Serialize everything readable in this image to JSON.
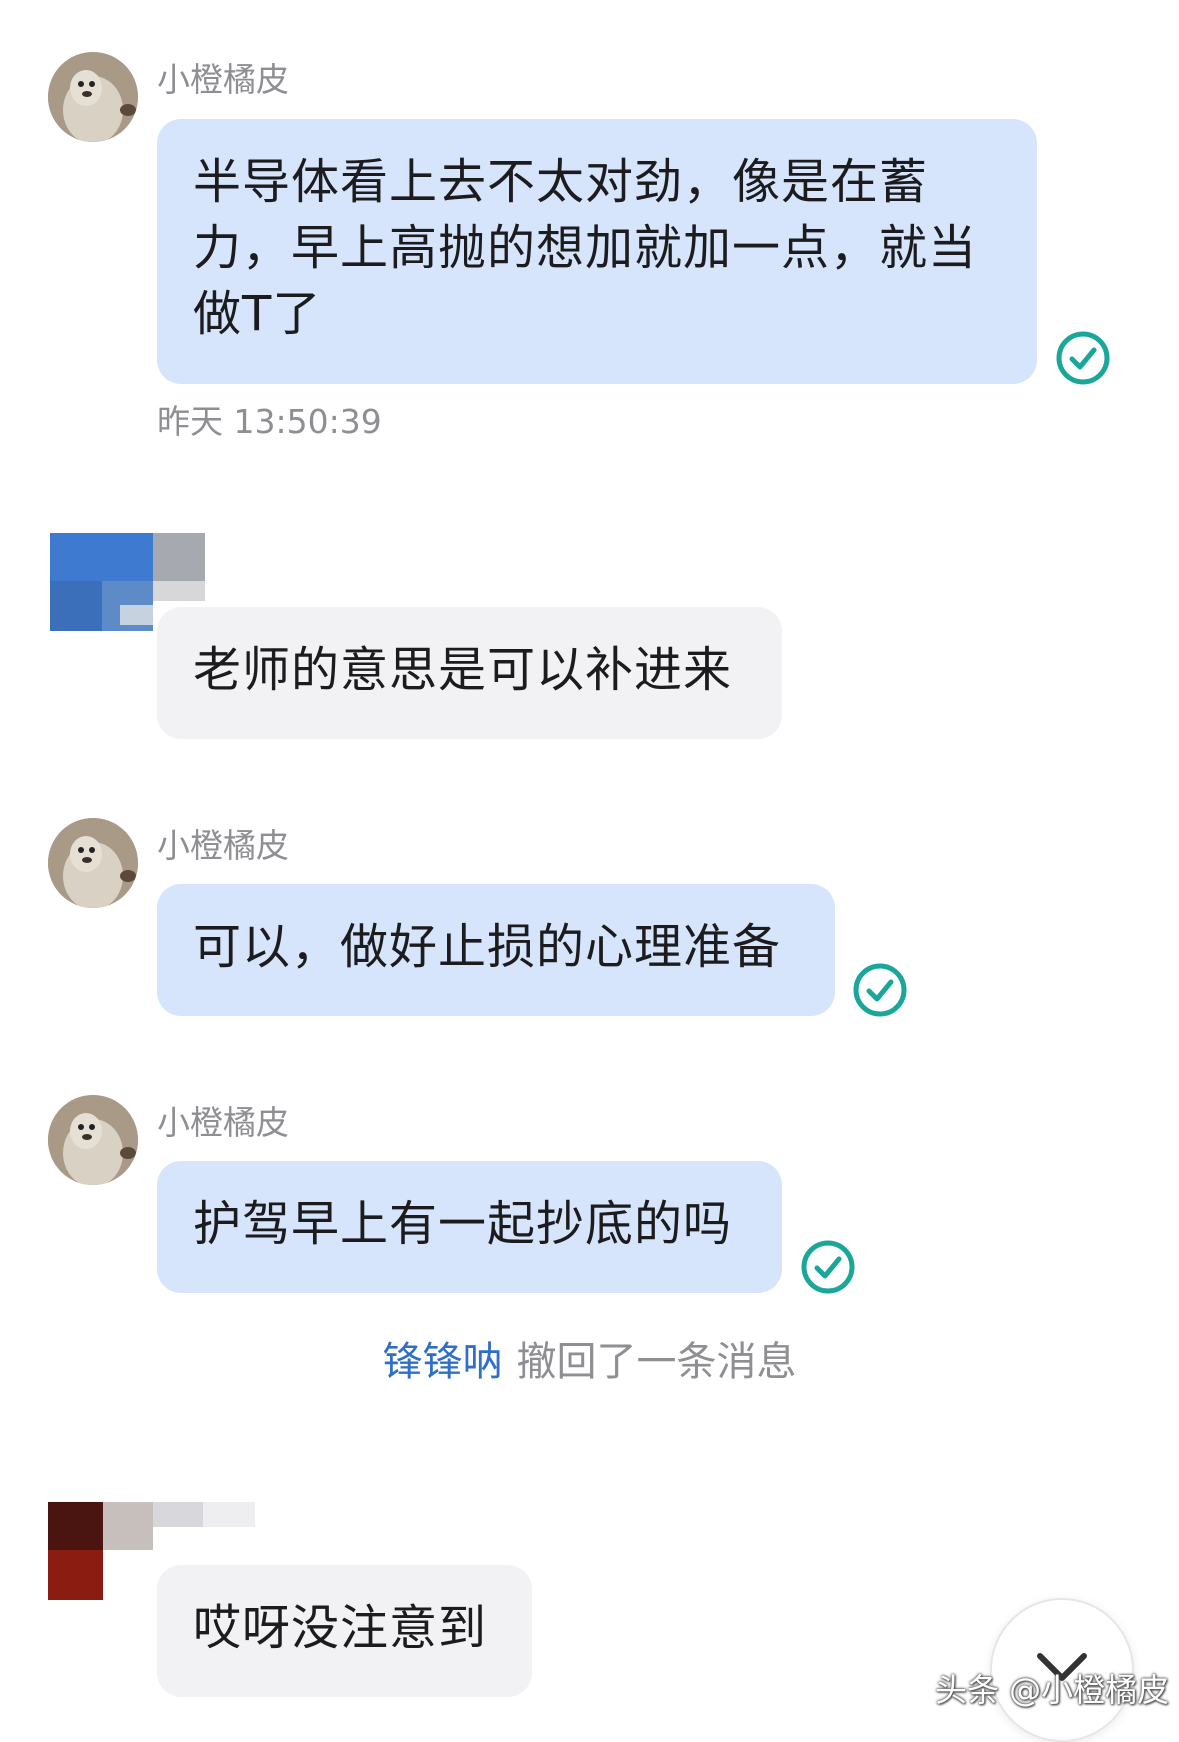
{
  "messages": [
    {
      "sender": "小橙橘皮",
      "text_lines": [
        "半导体看上去不太对劲，像是在蓄",
        "力，早上高抛的想加就加一点，就当",
        "做T了"
      ],
      "timestamp": "昨天 13:50:39",
      "read_icon": "check-circle-icon"
    },
    {
      "text": "老师的意思是可以补进来"
    },
    {
      "sender": "小橙橘皮",
      "text": "可以，做好止损的心理准备",
      "read_icon": "check-circle-icon"
    },
    {
      "sender": "小橙橘皮",
      "text": "护驾早上有一起抄底的吗",
      "read_icon": "check-circle-icon"
    },
    {
      "text": "哎呀没注意到"
    }
  ],
  "recall_notice": {
    "name": "锋锋呐",
    "text": "撤回了一条消息"
  },
  "scroll_button_icon": "chevron-down-icon",
  "watermark": "头条 @小橙橘皮",
  "colors": {
    "my_bubble": "#d6e5fc",
    "other_bubble": "#f2f2f4",
    "read_check": "#1aa79a",
    "recall_name": "#2f6fc9",
    "meta_text": "#8e8e93"
  }
}
